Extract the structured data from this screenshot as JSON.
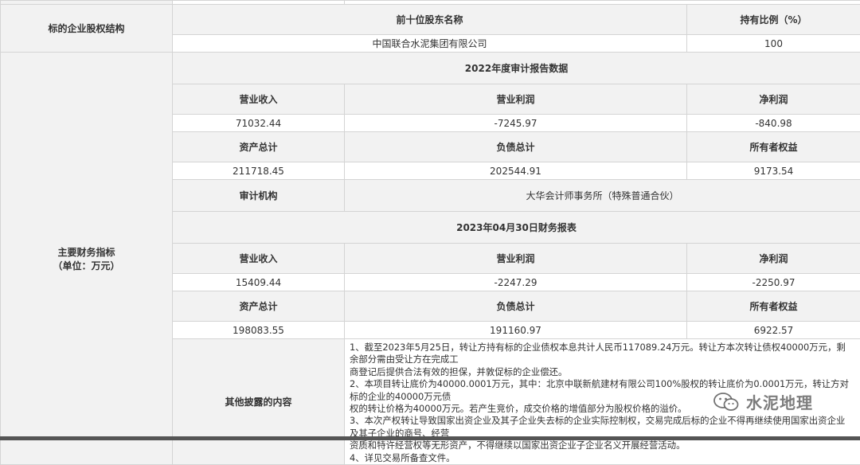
{
  "equity": {
    "row_label": "标的企业股权结构",
    "col_shareholder": "前十位股东名称",
    "col_ratio": "持有比例（%）",
    "shareholder": "中国联合水泥集团有限公司",
    "ratio": "100"
  },
  "financial": {
    "row_label_line1": "主要财务指标",
    "row_label_line2": "（单位：万元）",
    "audit2022": {
      "title": "2022年度审计报告数据",
      "h_revenue": "营业收入",
      "h_op_profit": "营业利润",
      "h_net_profit": "净利润",
      "revenue": "71032.44",
      "op_profit": "-7245.97",
      "net_profit": "-840.98",
      "h_assets": "资产总计",
      "h_liabilities": "负债总计",
      "h_equity": "所有者权益",
      "assets": "211718.45",
      "liabilities": "202544.91",
      "equity": "9173.54",
      "h_auditor": "审计机构",
      "auditor": "大华会计师事务所（特殊普通合伙）"
    },
    "report2023": {
      "title": "2023年04月30日财务报表",
      "h_revenue": "营业收入",
      "h_op_profit": "营业利润",
      "h_net_profit": "净利润",
      "revenue": "15409.44",
      "op_profit": "-2247.29",
      "net_profit": "-2250.97",
      "h_assets": "资产总计",
      "h_liabilities": "负债总计",
      "h_equity": "所有者权益",
      "assets": "198083.55",
      "liabilities": "191160.97",
      "equity": "6922.57"
    }
  },
  "other": {
    "row_label": "其他披露的内容",
    "lines": [
      "1、截至2023年5月25日，转让方持有标的企业债权本息共计人民币117089.24万元。转让方本次转让债权40000万元，剩余部分需由受让方在完成工",
      "商登记后提供合法有效的担保，并敦促标的企业偿还。",
      "2、本项目转让底价为40000.0001万元，其中：北京中联新航建材有限公司100%股权的转让底价为0.0001万元，转让方对标的企业的40000万元债",
      "权的转让价格为40000万元。若产生竞价，成交价格的增值部分为股权价格的溢价。",
      "3、本次产权转让导致国家出资企业及其子企业失去标的企业实际控制权，交易完成后标的企业不得再继续使用国家出资企业及其子企业的商号、经营",
      "资质和特许经营权等无形资产，不得继续以国家出资企业子企业名义开展经营活动。",
      "4、详见交易所备查文件。"
    ]
  },
  "watermark": {
    "text": "水泥地理",
    "icon": "wechat-icon"
  }
}
